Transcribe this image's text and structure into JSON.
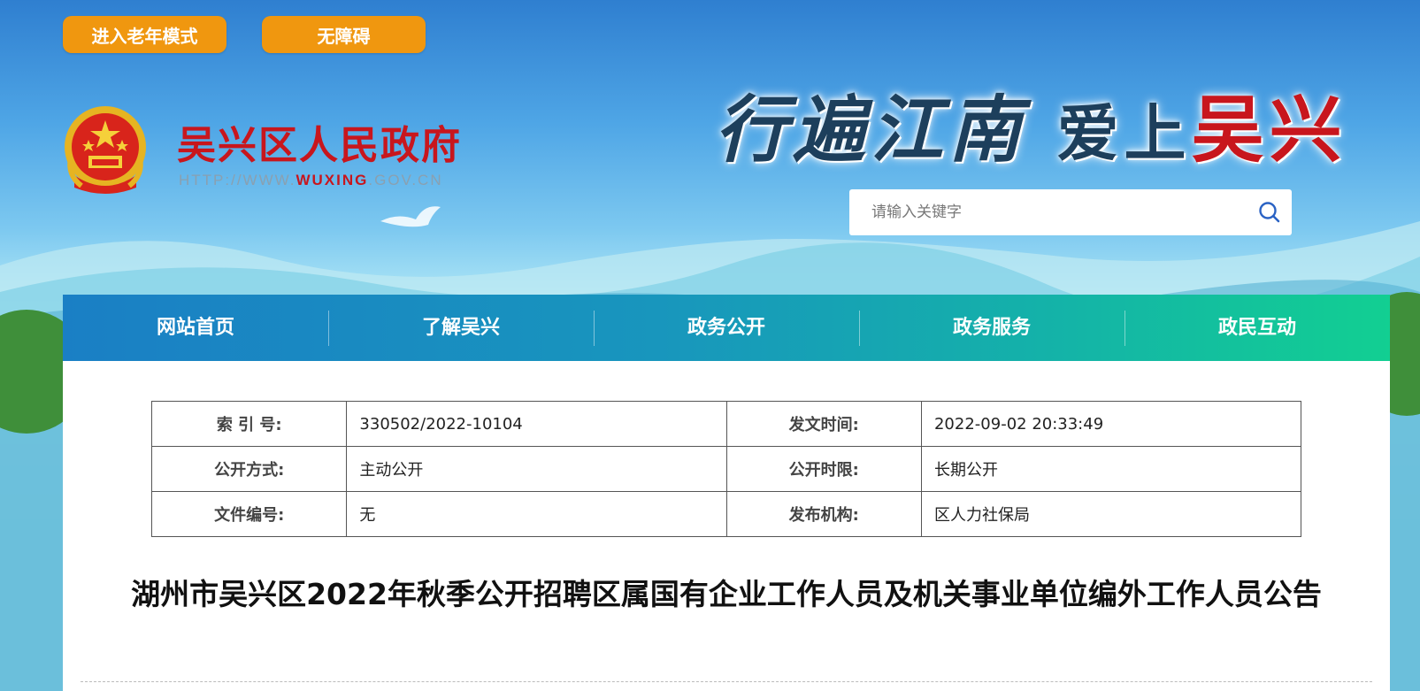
{
  "top_buttons": {
    "elder_mode": "进入老年模式",
    "accessibility": "无障碍"
  },
  "header": {
    "site_name": "吴兴区人民政府",
    "url_prefix": "HTTP://WWW.",
    "url_highlight": "WUXING",
    "url_suffix": ".GOV.CN",
    "slogan_part1": "行遍江南",
    "slogan_part2": "爱上",
    "slogan_part3": "吴兴"
  },
  "search": {
    "placeholder": "请输入关键字",
    "icon": "search-icon"
  },
  "nav": {
    "items": [
      {
        "label": "网站首页"
      },
      {
        "label": "了解吴兴"
      },
      {
        "label": "政务公开"
      },
      {
        "label": "政务服务"
      },
      {
        "label": "政民互动"
      }
    ]
  },
  "meta": {
    "rows": [
      {
        "l1": "索 引 号:",
        "v1": "330502/2022-10104",
        "l2": "发文时间:",
        "v2": "2022-09-02 20:33:49"
      },
      {
        "l1": "公开方式:",
        "v1": "主动公开",
        "l2": "公开时限:",
        "v2": "长期公开"
      },
      {
        "l1": "文件编号:",
        "v1": "无",
        "l2": "发布机构:",
        "v2": "区人力社保局"
      }
    ]
  },
  "article": {
    "title": "湖州市吴兴区2022年秋季公开招聘区属国有企业工作人员及机关事业单位编外工作人员公告"
  },
  "colors": {
    "accent": "#f0970f",
    "brand_red": "#c8161d",
    "nav_start": "#1a7fc5",
    "nav_end": "#12cf92"
  }
}
